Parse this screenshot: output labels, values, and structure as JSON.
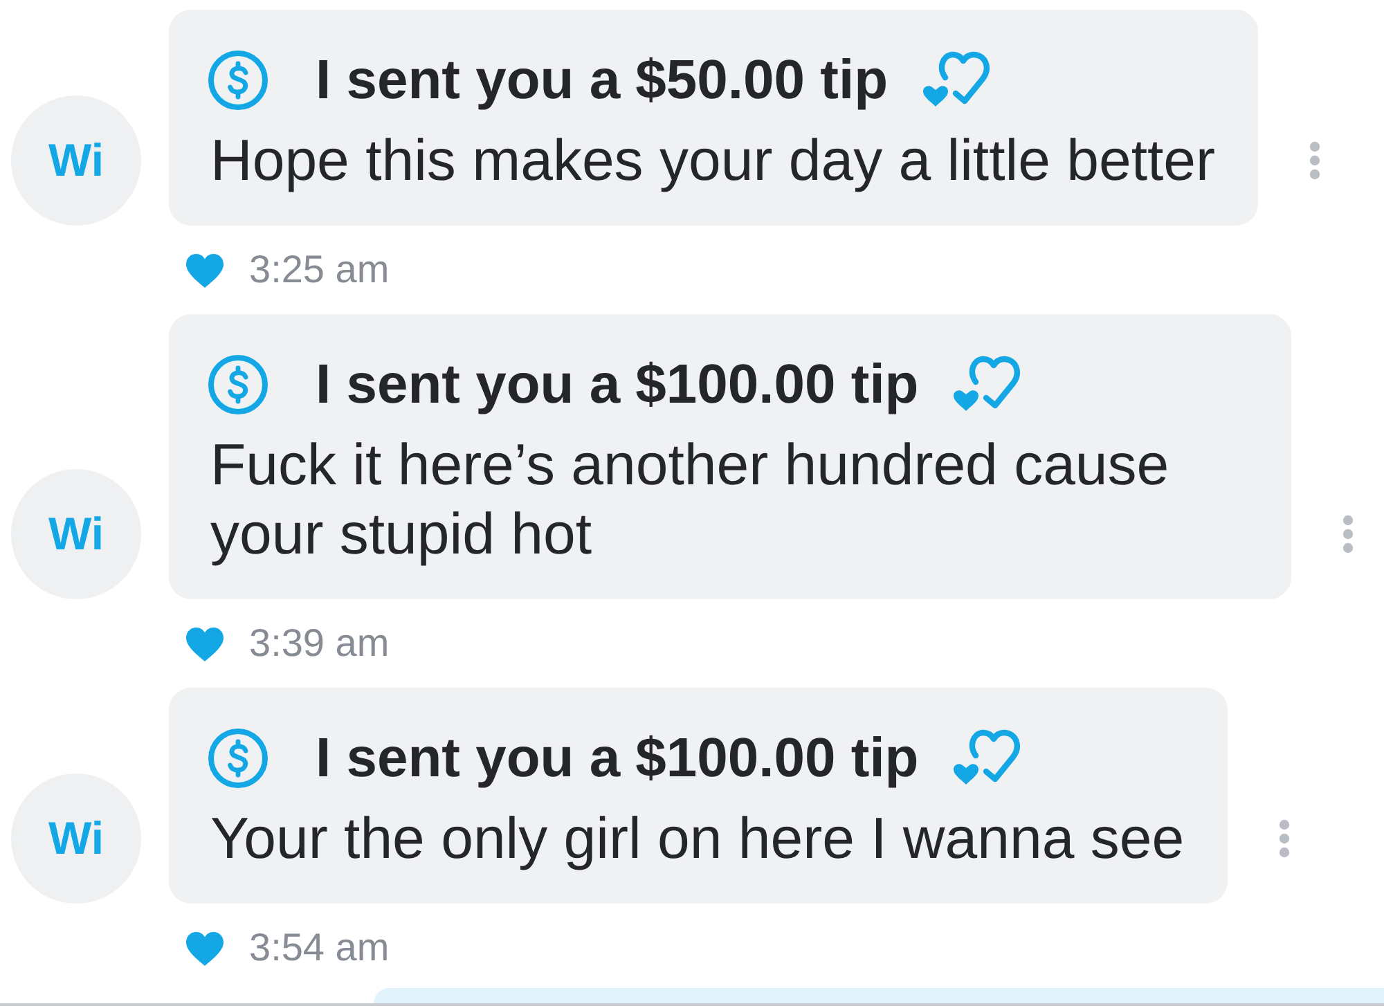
{
  "messages": [
    {
      "avatar": "Wi",
      "title": "I sent you a $50.00 tip",
      "text": "Hope this makes your day a little better",
      "liked": true,
      "time": "3:25 am"
    },
    {
      "avatar": "Wi",
      "title": "I sent you a $100.00 tip",
      "text": "Fuck it here’s another hundred cause your stupid hot",
      "liked": true,
      "time": "3:39 am"
    },
    {
      "avatar": "Wi",
      "title": "I sent you a $100.00 tip",
      "text": "Your the only girl on here I wanna see",
      "liked": true,
      "time": "3:54 am"
    }
  ]
}
